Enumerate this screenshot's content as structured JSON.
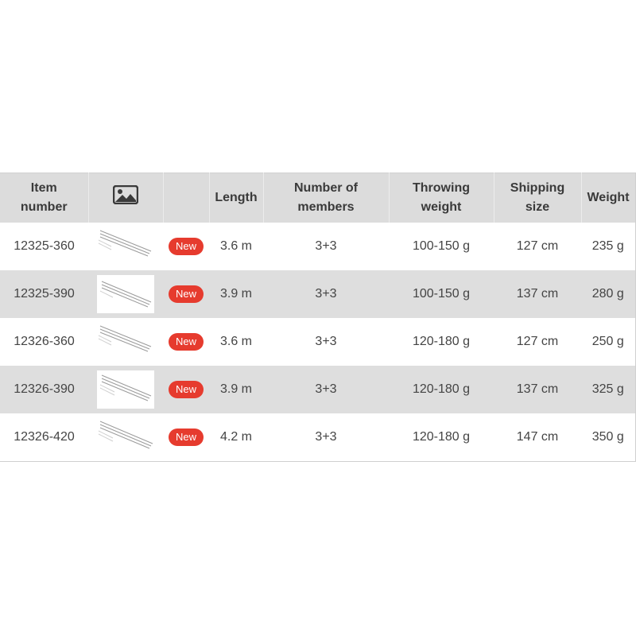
{
  "table": {
    "headers": {
      "item_number": "Item\nnumber",
      "image": "",
      "badge": "",
      "length": "Length",
      "members": "Number of\nmembers",
      "throwing_weight": "Throwing\nweight",
      "shipping_size": "Shipping\nsize",
      "weight": "Weight"
    },
    "image_header_icon": "image-icon",
    "rows": [
      {
        "item": "12325-360",
        "badge": "New",
        "length": "3.6 m",
        "members": "3+3",
        "throwing": "100-150 g",
        "shipping": "127 cm",
        "weight": "235 g"
      },
      {
        "item": "12325-390",
        "badge": "New",
        "length": "3.9 m",
        "members": "3+3",
        "throwing": "100-150 g",
        "shipping": "137 cm",
        "weight": "280 g"
      },
      {
        "item": "12326-360",
        "badge": "New",
        "length": "3.6 m",
        "members": "3+3",
        "throwing": "120-180 g",
        "shipping": "127 cm",
        "weight": "250 g"
      },
      {
        "item": "12326-390",
        "badge": "New",
        "length": "3.9 m",
        "members": "3+3",
        "throwing": "120-180 g",
        "shipping": "137 cm",
        "weight": "325 g"
      },
      {
        "item": "12326-420",
        "badge": "New",
        "length": "4.2 m",
        "members": "3+3",
        "throwing": "120-180 g",
        "shipping": "147 cm",
        "weight": "350 g"
      }
    ],
    "colors": {
      "header_bg": "#dcdcdc",
      "alt_row_bg": "#dedede",
      "badge_bg": "#e63b2e",
      "text": "#444444"
    }
  }
}
